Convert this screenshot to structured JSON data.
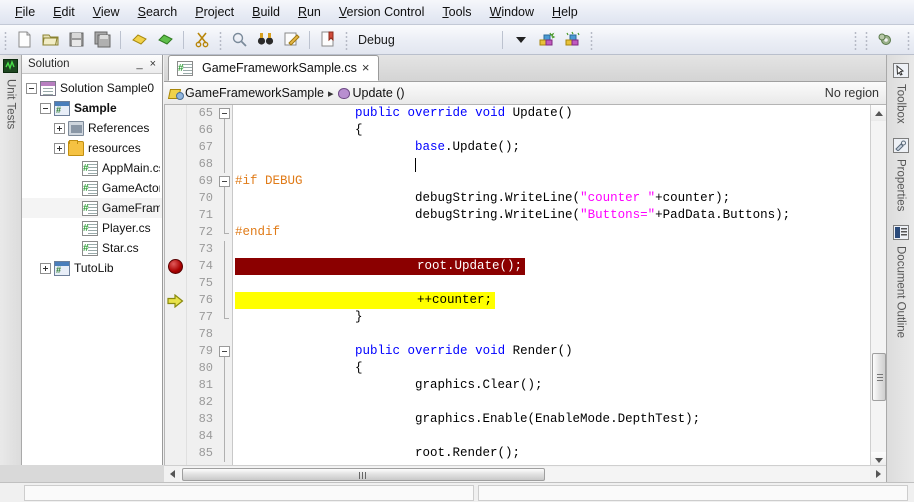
{
  "menubar": {
    "items": [
      {
        "label": "File",
        "mnemonic": "F"
      },
      {
        "label": "Edit",
        "mnemonic": "E"
      },
      {
        "label": "View",
        "mnemonic": "V"
      },
      {
        "label": "Search",
        "mnemonic": "S"
      },
      {
        "label": "Project",
        "mnemonic": "P"
      },
      {
        "label": "Build",
        "mnemonic": "B"
      },
      {
        "label": "Run",
        "mnemonic": "R"
      },
      {
        "label": "Version Control",
        "mnemonic": "V"
      },
      {
        "label": "Tools",
        "mnemonic": "T"
      },
      {
        "label": "Window",
        "mnemonic": "W"
      },
      {
        "label": "Help",
        "mnemonic": "H"
      }
    ]
  },
  "toolbar": {
    "icons": [
      "new-file-icon",
      "open-folder-icon",
      "save-icon",
      "save-all-icon",
      "undo-icon",
      "redo-icon",
      "cut-icon",
      "find-icon",
      "find-next-icon",
      "replace-icon",
      "bookmark-icon"
    ],
    "configuration": "Debug",
    "build_icon": "build-icon",
    "rebuild_icon": "rebuild-icon",
    "settings_icon": "gear-icon"
  },
  "left_dock": {
    "tabs": [
      {
        "label": "Unit Tests",
        "icon": "unit-tests-icon"
      }
    ]
  },
  "solution_panel": {
    "title": "Solution",
    "minimize_label": "_",
    "close_label": "×",
    "tree": [
      {
        "label": "Solution Sample0",
        "icon": "solution-icon",
        "depth": 0,
        "expander": "minus",
        "bold": false
      },
      {
        "label": "Sample",
        "icon": "project-icon",
        "depth": 1,
        "expander": "minus",
        "bold": true
      },
      {
        "label": "References",
        "icon": "references-icon",
        "depth": 2,
        "expander": "plus",
        "bold": false
      },
      {
        "label": "resources",
        "icon": "folder-icon",
        "depth": 2,
        "expander": "plus",
        "bold": false
      },
      {
        "label": "AppMain.cs",
        "icon": "csharp-file-icon",
        "depth": 3,
        "expander": "none",
        "bold": false
      },
      {
        "label": "GameActor.c",
        "icon": "csharp-file-icon",
        "depth": 3,
        "expander": "none",
        "bold": false
      },
      {
        "label": "GameFrame",
        "icon": "csharp-file-icon",
        "depth": 3,
        "expander": "none",
        "bold": false,
        "selected": true
      },
      {
        "label": "Player.cs",
        "icon": "csharp-file-icon",
        "depth": 3,
        "expander": "none",
        "bold": false
      },
      {
        "label": "Star.cs",
        "icon": "csharp-file-icon",
        "depth": 3,
        "expander": "none",
        "bold": false
      },
      {
        "label": "TutoLib",
        "icon": "project-icon",
        "depth": 1,
        "expander": "plus",
        "bold": false
      }
    ]
  },
  "editor": {
    "tab": {
      "label": "GameFrameworkSample.cs",
      "icon": "csharp-file-icon",
      "close": "×"
    },
    "breadcrumb": {
      "class": "GameFrameworkSample",
      "separator": "▸",
      "member": "Update ()",
      "region": "No region"
    },
    "first_line": 65,
    "lines": [
      {
        "n": 65,
        "fold": "box",
        "indent": 8,
        "tokens": [
          {
            "t": "public ",
            "c": "kw"
          },
          {
            "t": "override ",
            "c": "kw"
          },
          {
            "t": "void ",
            "c": "kw"
          },
          {
            "t": "Update()",
            "c": ""
          }
        ]
      },
      {
        "n": 66,
        "fold": "line",
        "indent": 8,
        "tokens": [
          {
            "t": "{",
            "c": ""
          }
        ]
      },
      {
        "n": 67,
        "fold": "line",
        "indent": 12,
        "tokens": [
          {
            "t": "base",
            "c": "kw"
          },
          {
            "t": ".Update();",
            "c": ""
          }
        ]
      },
      {
        "n": 68,
        "fold": "line",
        "indent": 12,
        "tokens": [
          {
            "t": "",
            "c": ""
          }
        ],
        "cursor": true
      },
      {
        "n": 69,
        "fold": "box",
        "indent": 0,
        "tokens": [
          {
            "t": "#if DEBUG",
            "c": "pp"
          }
        ]
      },
      {
        "n": 70,
        "fold": "line",
        "indent": 12,
        "tokens": [
          {
            "t": "debugString.WriteLine(",
            "c": ""
          },
          {
            "t": "\"counter \"",
            "c": "str"
          },
          {
            "t": "+counter);",
            "c": ""
          }
        ]
      },
      {
        "n": 71,
        "fold": "line",
        "indent": 12,
        "tokens": [
          {
            "t": "debugString.WriteLine(",
            "c": ""
          },
          {
            "t": "\"Buttons=\"",
            "c": "str"
          },
          {
            "t": "+PadData.Buttons);",
            "c": ""
          }
        ]
      },
      {
        "n": 72,
        "fold": "end",
        "indent": 0,
        "tokens": [
          {
            "t": "#endif",
            "c": "pp"
          }
        ]
      },
      {
        "n": 73,
        "fold": "line",
        "indent": 0,
        "tokens": [
          {
            "t": "",
            "c": ""
          }
        ]
      },
      {
        "n": 74,
        "fold": "line",
        "indent": 12,
        "tokens": [
          {
            "t": "root.Update();",
            "c": ""
          }
        ],
        "breakpoint": true,
        "highlight": "breakpoint"
      },
      {
        "n": 75,
        "fold": "line",
        "indent": 0,
        "tokens": [
          {
            "t": "",
            "c": ""
          }
        ]
      },
      {
        "n": 76,
        "fold": "line",
        "indent": 12,
        "tokens": [
          {
            "t": "++counter;",
            "c": ""
          }
        ],
        "execution": true,
        "highlight": "execution"
      },
      {
        "n": 77,
        "fold": "end",
        "indent": 8,
        "tokens": [
          {
            "t": "}",
            "c": ""
          }
        ]
      },
      {
        "n": 78,
        "fold": "none",
        "indent": 0,
        "tokens": [
          {
            "t": "",
            "c": ""
          }
        ]
      },
      {
        "n": 79,
        "fold": "box",
        "indent": 8,
        "tokens": [
          {
            "t": "public ",
            "c": "kw"
          },
          {
            "t": "override ",
            "c": "kw"
          },
          {
            "t": "void ",
            "c": "kw"
          },
          {
            "t": "Render()",
            "c": ""
          }
        ]
      },
      {
        "n": 80,
        "fold": "line",
        "indent": 8,
        "tokens": [
          {
            "t": "{",
            "c": ""
          }
        ]
      },
      {
        "n": 81,
        "fold": "line",
        "indent": 12,
        "tokens": [
          {
            "t": "graphics.Clear();",
            "c": ""
          }
        ]
      },
      {
        "n": 82,
        "fold": "line",
        "indent": 0,
        "tokens": [
          {
            "t": "",
            "c": ""
          }
        ]
      },
      {
        "n": 83,
        "fold": "line",
        "indent": 12,
        "tokens": [
          {
            "t": "graphics.Enable(EnableMode.DepthTest);",
            "c": ""
          }
        ]
      },
      {
        "n": 84,
        "fold": "line",
        "indent": 0,
        "tokens": [
          {
            "t": "",
            "c": ""
          }
        ]
      },
      {
        "n": 85,
        "fold": "line",
        "indent": 12,
        "tokens": [
          {
            "t": "root.Render();",
            "c": ""
          }
        ]
      }
    ]
  },
  "right_dock": {
    "tabs": [
      {
        "label": "Toolbox",
        "icon": "toolbox-icon"
      },
      {
        "label": "Properties",
        "icon": "properties-icon"
      },
      {
        "label": "Document Outline",
        "icon": "document-outline-icon"
      }
    ]
  },
  "colors": {
    "keyword": "#0000ff",
    "string": "#ff00ff",
    "preprocessor": "#e07b18",
    "breakpoint_bg": "#8b0000",
    "execution_bg": "#ffff00"
  }
}
